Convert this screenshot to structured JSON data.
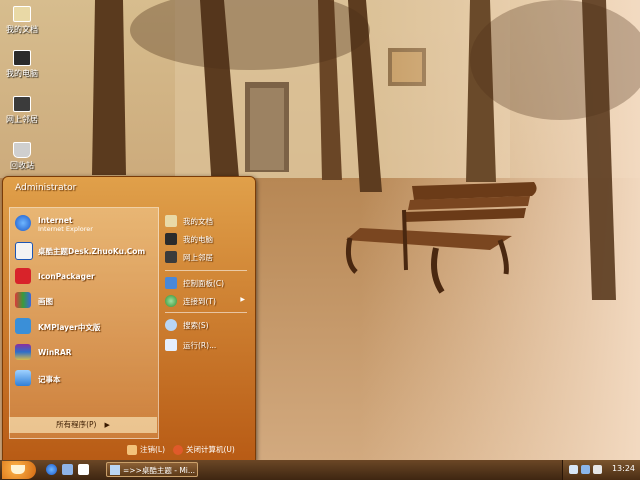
{
  "desktop": {
    "icons": [
      {
        "label": "我的文档",
        "icon": "folder-documents-icon"
      },
      {
        "label": "我的电脑",
        "icon": "computer-icon"
      },
      {
        "label": "网上邻居",
        "icon": "network-icon"
      },
      {
        "label": "回收站",
        "icon": "recycle-bin-icon"
      }
    ]
  },
  "start_menu": {
    "user": "Administrator",
    "pinned": [
      {
        "title": "Internet",
        "subtitle": "Internet Explorer",
        "icon": "internet-explorer-icon"
      },
      {
        "title": "桌酷主题Desk.ZhuoKu.Com",
        "icon": "zhuoku-icon"
      },
      {
        "title": "IconPackager",
        "icon": "iconpackager-icon"
      },
      {
        "title": "画图",
        "icon": "paint-icon"
      },
      {
        "title": "KMPlayer中文版",
        "icon": "kmplayer-icon"
      },
      {
        "title": "WinRAR",
        "icon": "winrar-icon"
      },
      {
        "title": "记事本",
        "icon": "notepad-icon"
      }
    ],
    "all_programs": "所有程序(P)",
    "right_items": [
      {
        "label": "我的文档",
        "icon": "my-documents-icon"
      },
      {
        "label": "我的电脑",
        "icon": "my-computer-icon"
      },
      {
        "label": "网上邻居",
        "icon": "network-places-icon"
      },
      {
        "label": "控制面板(C)",
        "icon": "control-panel-icon"
      },
      {
        "label": "连接到(T)",
        "icon": "connect-to-icon",
        "has_submenu": true
      },
      {
        "label": "搜索(S)",
        "icon": "search-icon"
      },
      {
        "label": "运行(R)...",
        "icon": "run-icon"
      }
    ],
    "log_off": "注销(L)",
    "shut_down": "关闭计算机(U)"
  },
  "taskbar": {
    "task_title": "=>>桌酷主题 - Mi...",
    "clock": "13:24"
  },
  "colors": {
    "menu_top": "#e0a04a",
    "menu_bottom": "#b85b15",
    "taskbar": "#4a2d14",
    "start_button": "#d46a12"
  }
}
